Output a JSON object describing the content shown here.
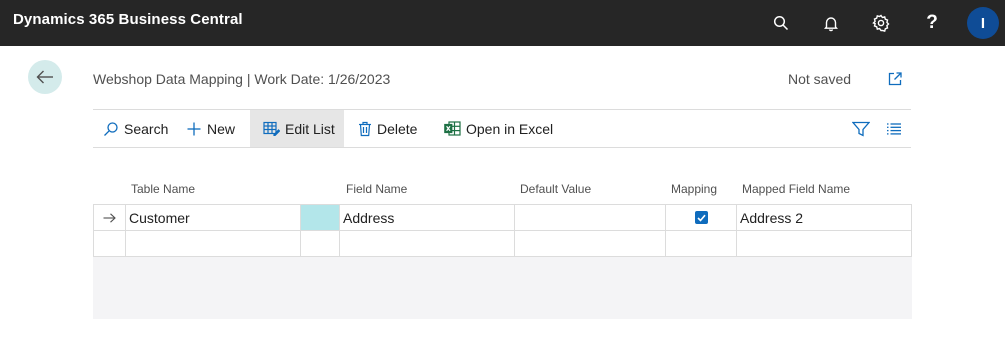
{
  "app": {
    "title": "Dynamics 365 Business Central",
    "avatar_initial": "I",
    "help_label": "?"
  },
  "icons": {
    "search": "search-icon",
    "notifications": "bell-icon",
    "settings": "gear-icon",
    "help": "help-icon",
    "back": "back-arrow-icon",
    "open_new": "open-in-new-window-icon",
    "filter": "filter-icon",
    "list_view": "list-view-icon",
    "row_indicator": "arrow-right-icon"
  },
  "page": {
    "title": "Webshop Data Mapping | Work Date: 1/26/2023",
    "save_status": "Not saved"
  },
  "actions": {
    "search": "Search",
    "new": "New",
    "edit_list": "Edit List",
    "delete": "Delete",
    "open_in_excel": "Open in Excel"
  },
  "table": {
    "columns": [
      "Table Name",
      "Field Name",
      "Default Value",
      "Mapping",
      "Mapped Field Name"
    ],
    "rows": [
      {
        "table_name": "Customer",
        "field_name": "Address",
        "default_value": "",
        "mapping": true,
        "mapped_field_name": "Address 2"
      },
      {
        "table_name": "",
        "field_name": "",
        "default_value": "",
        "mapping": false,
        "mapped_field_name": ""
      }
    ]
  },
  "colors": {
    "topbar": "#262626",
    "avatar": "#0f4c96",
    "accent": "#0f6cbd",
    "back_button_bg": "#d4ebeb",
    "selected_cell": "#b3e6ea"
  }
}
